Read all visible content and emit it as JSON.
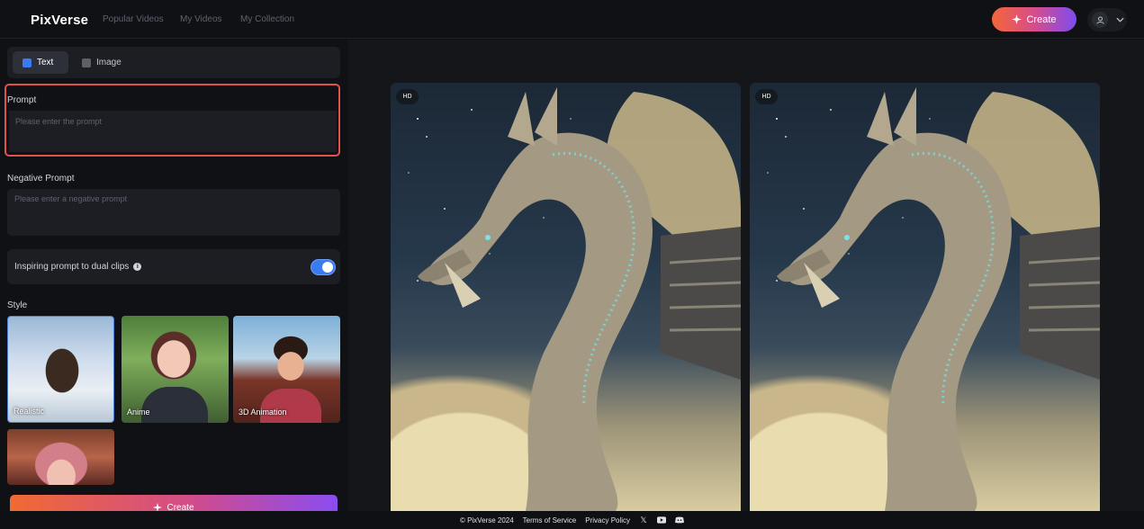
{
  "header": {
    "logo": "PixVerse",
    "nav": [
      "Popular Videos",
      "My Videos",
      "My Collection"
    ],
    "create_label": "Create"
  },
  "left_panel": {
    "modes": [
      {
        "label": "Text",
        "active": true
      },
      {
        "label": "Image",
        "active": false
      }
    ],
    "prompt": {
      "label": "Prompt",
      "placeholder": "Please enter the prompt",
      "value": ""
    },
    "negative_prompt": {
      "label": "Negative Prompt",
      "placeholder": "Please enter a negative prompt",
      "value": ""
    },
    "inspiring": {
      "label": "Inspiring prompt to dual clips",
      "enabled": true
    },
    "style": {
      "label": "Style",
      "options": [
        {
          "label": "Realistic",
          "selected": true
        },
        {
          "label": "Anime",
          "selected": false
        },
        {
          "label": "3D Animation",
          "selected": false
        },
        {
          "label": "",
          "selected": false
        }
      ]
    },
    "create_label": "Create"
  },
  "main": {
    "videos": [
      {
        "badge": "HD"
      },
      {
        "badge": "HD"
      }
    ]
  },
  "footer": {
    "copyright": "© PixVerse 2024",
    "terms": "Terms of Service",
    "privacy": "Privacy Policy",
    "social_icons": [
      "x-icon",
      "youtube-icon",
      "discord-icon"
    ]
  },
  "colors": {
    "accent_blue": "#3a7bf2",
    "prompt_highlight": "#e0524f",
    "create_gradient_start": "#f4663a",
    "create_gradient_end": "#7d4cf0"
  }
}
